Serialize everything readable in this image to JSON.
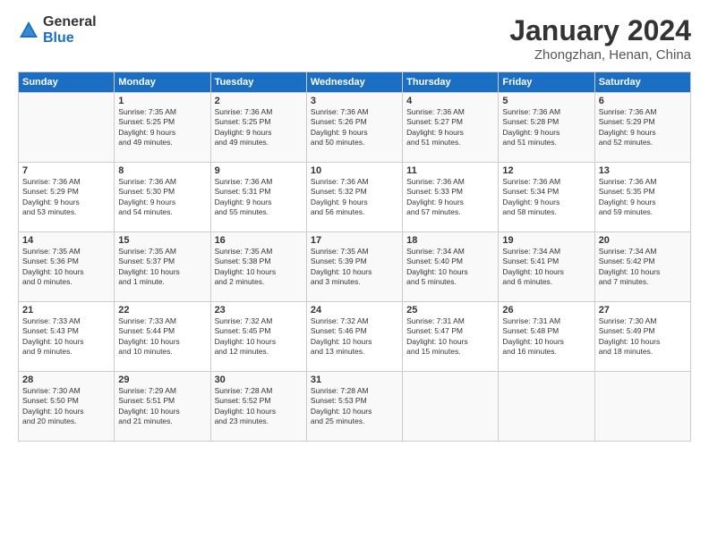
{
  "logo": {
    "general": "General",
    "blue": "Blue"
  },
  "header": {
    "title": "January 2024",
    "subtitle": "Zhongzhan, Henan, China"
  },
  "days_of_week": [
    "Sunday",
    "Monday",
    "Tuesday",
    "Wednesday",
    "Thursday",
    "Friday",
    "Saturday"
  ],
  "weeks": [
    [
      {
        "day": "",
        "info": ""
      },
      {
        "day": "1",
        "info": "Sunrise: 7:35 AM\nSunset: 5:25 PM\nDaylight: 9 hours\nand 49 minutes."
      },
      {
        "day": "2",
        "info": "Sunrise: 7:36 AM\nSunset: 5:25 PM\nDaylight: 9 hours\nand 49 minutes."
      },
      {
        "day": "3",
        "info": "Sunrise: 7:36 AM\nSunset: 5:26 PM\nDaylight: 9 hours\nand 50 minutes."
      },
      {
        "day": "4",
        "info": "Sunrise: 7:36 AM\nSunset: 5:27 PM\nDaylight: 9 hours\nand 51 minutes."
      },
      {
        "day": "5",
        "info": "Sunrise: 7:36 AM\nSunset: 5:28 PM\nDaylight: 9 hours\nand 51 minutes."
      },
      {
        "day": "6",
        "info": "Sunrise: 7:36 AM\nSunset: 5:29 PM\nDaylight: 9 hours\nand 52 minutes."
      }
    ],
    [
      {
        "day": "7",
        "info": "Sunrise: 7:36 AM\nSunset: 5:29 PM\nDaylight: 9 hours\nand 53 minutes."
      },
      {
        "day": "8",
        "info": "Sunrise: 7:36 AM\nSunset: 5:30 PM\nDaylight: 9 hours\nand 54 minutes."
      },
      {
        "day": "9",
        "info": "Sunrise: 7:36 AM\nSunset: 5:31 PM\nDaylight: 9 hours\nand 55 minutes."
      },
      {
        "day": "10",
        "info": "Sunrise: 7:36 AM\nSunset: 5:32 PM\nDaylight: 9 hours\nand 56 minutes."
      },
      {
        "day": "11",
        "info": "Sunrise: 7:36 AM\nSunset: 5:33 PM\nDaylight: 9 hours\nand 57 minutes."
      },
      {
        "day": "12",
        "info": "Sunrise: 7:36 AM\nSunset: 5:34 PM\nDaylight: 9 hours\nand 58 minutes."
      },
      {
        "day": "13",
        "info": "Sunrise: 7:36 AM\nSunset: 5:35 PM\nDaylight: 9 hours\nand 59 minutes."
      }
    ],
    [
      {
        "day": "14",
        "info": "Sunrise: 7:35 AM\nSunset: 5:36 PM\nDaylight: 10 hours\nand 0 minutes."
      },
      {
        "day": "15",
        "info": "Sunrise: 7:35 AM\nSunset: 5:37 PM\nDaylight: 10 hours\nand 1 minute."
      },
      {
        "day": "16",
        "info": "Sunrise: 7:35 AM\nSunset: 5:38 PM\nDaylight: 10 hours\nand 2 minutes."
      },
      {
        "day": "17",
        "info": "Sunrise: 7:35 AM\nSunset: 5:39 PM\nDaylight: 10 hours\nand 3 minutes."
      },
      {
        "day": "18",
        "info": "Sunrise: 7:34 AM\nSunset: 5:40 PM\nDaylight: 10 hours\nand 5 minutes."
      },
      {
        "day": "19",
        "info": "Sunrise: 7:34 AM\nSunset: 5:41 PM\nDaylight: 10 hours\nand 6 minutes."
      },
      {
        "day": "20",
        "info": "Sunrise: 7:34 AM\nSunset: 5:42 PM\nDaylight: 10 hours\nand 7 minutes."
      }
    ],
    [
      {
        "day": "21",
        "info": "Sunrise: 7:33 AM\nSunset: 5:43 PM\nDaylight: 10 hours\nand 9 minutes."
      },
      {
        "day": "22",
        "info": "Sunrise: 7:33 AM\nSunset: 5:44 PM\nDaylight: 10 hours\nand 10 minutes."
      },
      {
        "day": "23",
        "info": "Sunrise: 7:32 AM\nSunset: 5:45 PM\nDaylight: 10 hours\nand 12 minutes."
      },
      {
        "day": "24",
        "info": "Sunrise: 7:32 AM\nSunset: 5:46 PM\nDaylight: 10 hours\nand 13 minutes."
      },
      {
        "day": "25",
        "info": "Sunrise: 7:31 AM\nSunset: 5:47 PM\nDaylight: 10 hours\nand 15 minutes."
      },
      {
        "day": "26",
        "info": "Sunrise: 7:31 AM\nSunset: 5:48 PM\nDaylight: 10 hours\nand 16 minutes."
      },
      {
        "day": "27",
        "info": "Sunrise: 7:30 AM\nSunset: 5:49 PM\nDaylight: 10 hours\nand 18 minutes."
      }
    ],
    [
      {
        "day": "28",
        "info": "Sunrise: 7:30 AM\nSunset: 5:50 PM\nDaylight: 10 hours\nand 20 minutes."
      },
      {
        "day": "29",
        "info": "Sunrise: 7:29 AM\nSunset: 5:51 PM\nDaylight: 10 hours\nand 21 minutes."
      },
      {
        "day": "30",
        "info": "Sunrise: 7:28 AM\nSunset: 5:52 PM\nDaylight: 10 hours\nand 23 minutes."
      },
      {
        "day": "31",
        "info": "Sunrise: 7:28 AM\nSunset: 5:53 PM\nDaylight: 10 hours\nand 25 minutes."
      },
      {
        "day": "",
        "info": ""
      },
      {
        "day": "",
        "info": ""
      },
      {
        "day": "",
        "info": ""
      }
    ]
  ]
}
